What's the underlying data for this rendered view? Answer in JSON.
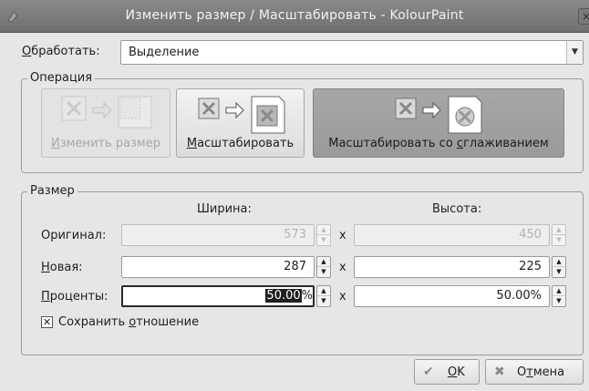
{
  "window": {
    "title": "Изменить размер / Масштабировать - KolourPaint",
    "close_glyph": "×"
  },
  "apply_to": {
    "label_mnemonic": "О",
    "label_rest": "бработать:",
    "selected_value": "Выделение"
  },
  "operation": {
    "group_title": "Операция",
    "buttons": [
      {
        "label_before": "",
        "mnemonic": "И",
        "label_after": "зменить размер",
        "state": "disabled"
      },
      {
        "label_before": "",
        "mnemonic": "М",
        "label_after": "асштабировать",
        "state": "normal"
      },
      {
        "label_before": "Масштабировать со ",
        "mnemonic": "с",
        "label_after": "глаживанием",
        "state": "active"
      }
    ]
  },
  "size": {
    "group_title": "Размер",
    "width_header": "Ширина:",
    "height_header": "Высота:",
    "times_sign": "x",
    "rows": [
      {
        "label_mnemonic": "",
        "label_rest": "Оригинал:",
        "width": "573",
        "height": "450",
        "disabled": true
      },
      {
        "label_mnemonic": "Н",
        "label_rest": "овая:",
        "width": "287",
        "height": "225",
        "disabled": false
      },
      {
        "label_mnemonic": "П",
        "label_rest": "роценты:",
        "width_selected": "50.00",
        "width_suffix": "%",
        "height": "50.00%",
        "disabled": false
      }
    ],
    "keep_ratio": {
      "checked": true,
      "label_before": "Сохранить ",
      "mnemonic": "о",
      "label_after": "тношение"
    }
  },
  "footer": {
    "ok": {
      "mnemonic": "O",
      "rest": "K",
      "icon": "check-icon"
    },
    "cancel": {
      "before": "О",
      "mnemonic": "т",
      "after": "мена",
      "icon": "cancel-x-icon"
    }
  },
  "icons": [
    "kolourpaint-app-icon",
    "arrow-right-icon",
    "kde-gear-icon",
    "spin-up-icon",
    "spin-down-icon",
    "dropdown-arrow-icon"
  ]
}
